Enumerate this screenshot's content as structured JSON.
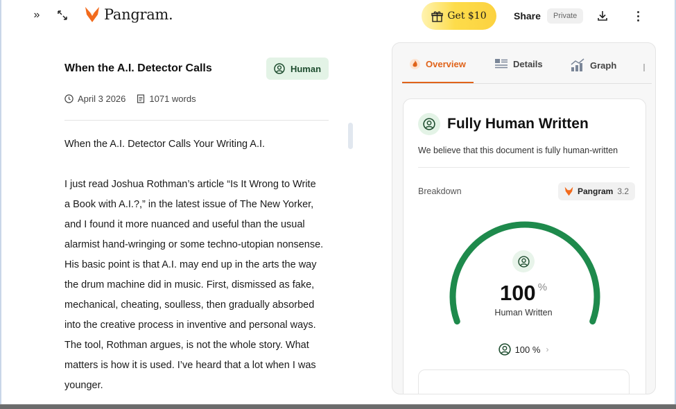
{
  "header": {
    "brand": "Pangram.",
    "promo_label": "Get $10",
    "share_label": "Share",
    "visibility_label": "Private"
  },
  "document": {
    "title": "When the A.I. Detector Calls",
    "badge_label": "Human",
    "date": "April 3 2026",
    "word_count": "1071 words",
    "heading_line": "When the A.I. Detector Calls Your Writing A.I.",
    "paragraph_lines": [
      "I just  read Joshua Rothman’s article “Is It Wrong to Write",
      "a Book with A.I.?,” in the latest issue of The New Yorker,",
      "and I found it more nuanced and useful than the usual",
      "alarmist hand-wringing or some techno-utopian nonsense.",
      "His basic point is that A.I. may end up in the arts the way",
      "the drum machine did in music. First, dismissed as fake,",
      "mechanical, cheating, soulless, then gradually absorbed",
      "into the creative process in inventive and personal ways.",
      "The tool, Rothman argues, is not the whole story. What",
      "matters is how it is used.  I’ve heard that a lot when I was",
      "younger."
    ]
  },
  "panel": {
    "tabs": [
      {
        "label": "Overview",
        "active": true
      },
      {
        "label": "Details",
        "active": false
      },
      {
        "label": "Graph",
        "active": false
      }
    ],
    "result_title": "Fully Human Written",
    "result_subtitle": "We believe that this document is fully human-written",
    "breakdown_label": "Breakdown",
    "model_name": "Pangram",
    "model_version": "3.2",
    "gauge_value": "100",
    "gauge_unit": "%",
    "gauge_fraction": 1.0,
    "gauge_caption": "Human Written",
    "score_label": "100 %"
  },
  "colors": {
    "accent_orange": "#e0631a",
    "human_green": "#1e8a4c",
    "badge_green_bg": "#e3f3e6",
    "promo_yellow": "#fcd240"
  }
}
